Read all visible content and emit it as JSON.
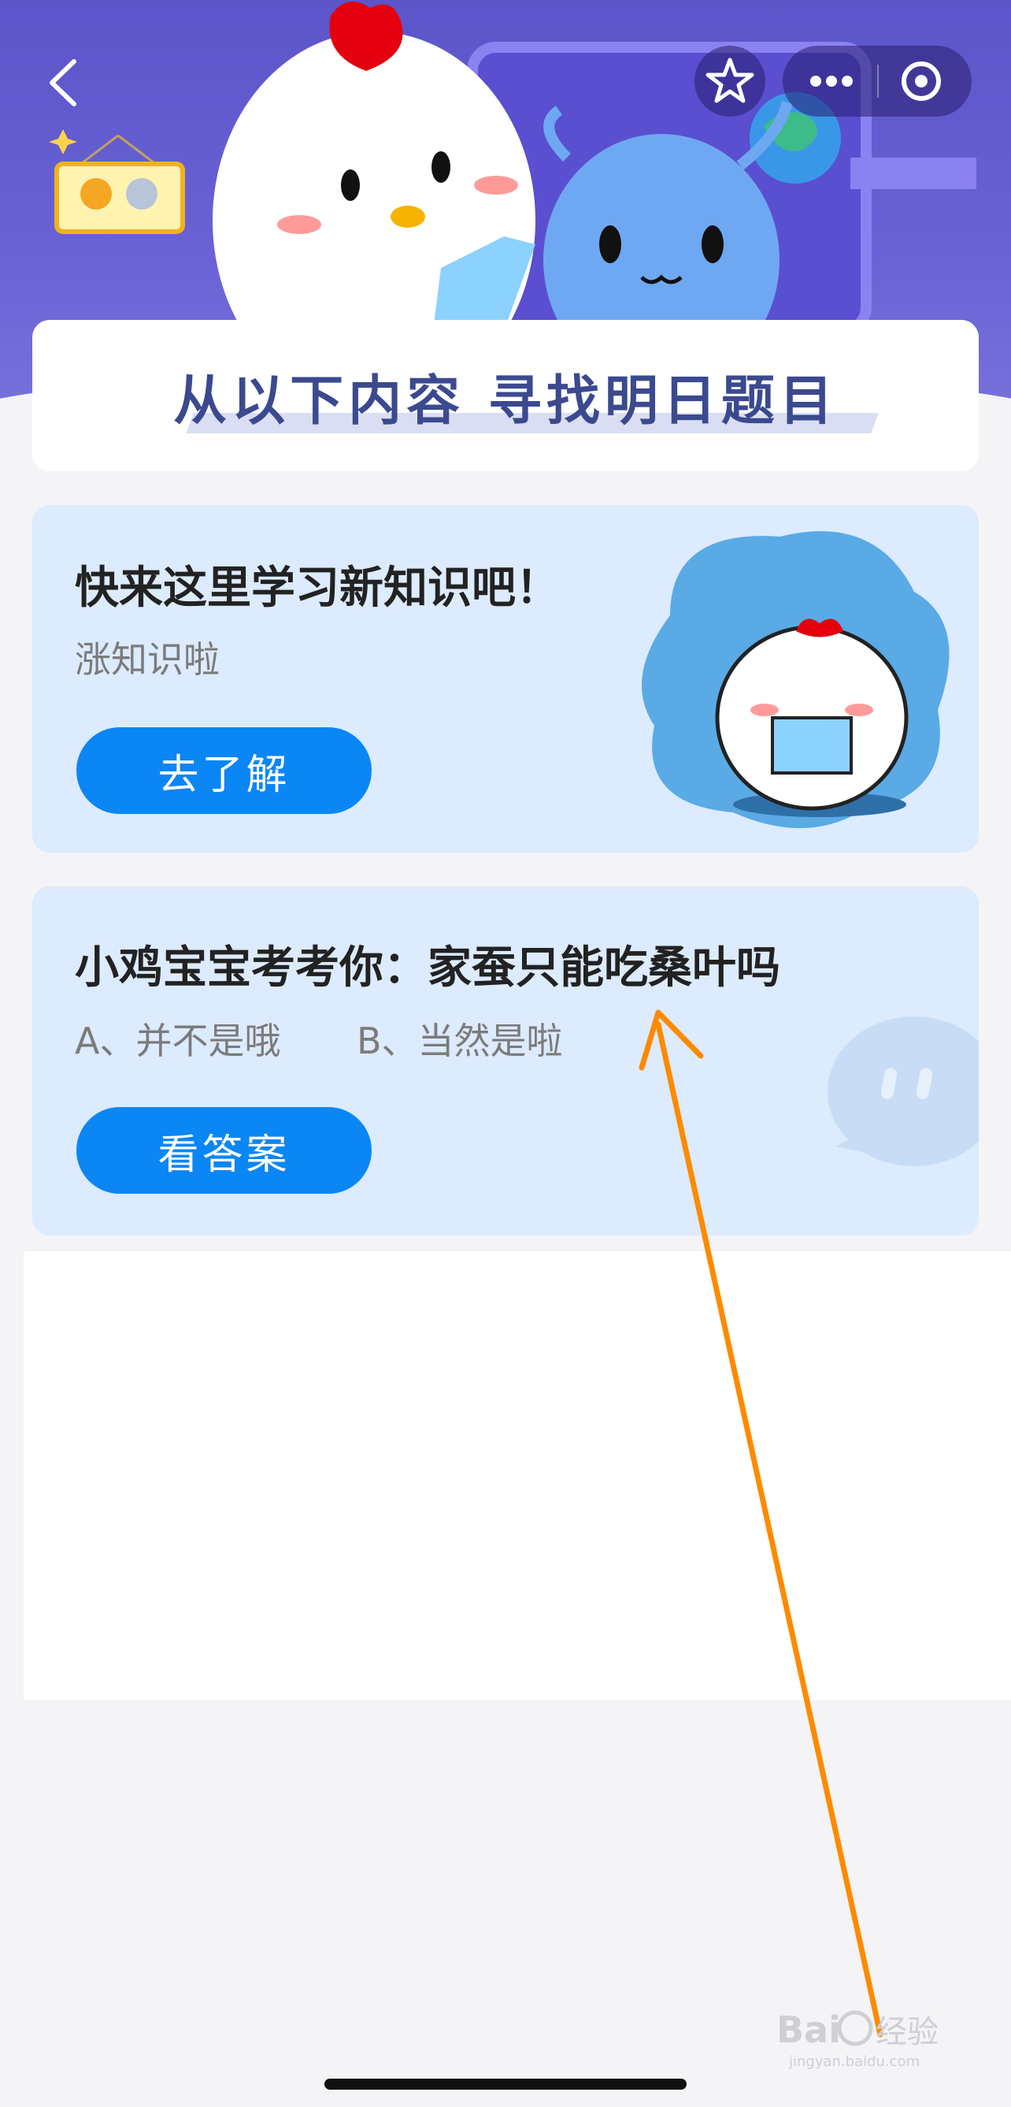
{
  "header": {
    "back_icon": "chevron-left-icon",
    "favorite_icon": "star-icon",
    "more_icon": "more-dots-icon",
    "close_icon": "target-icon",
    "hero_colors": {
      "top": "#5b55c9",
      "bottom": "#7a74dc"
    }
  },
  "banner": {
    "title": "从以下内容  寻找明日题目"
  },
  "card_learn": {
    "title": "快来这里学习新知识吧！",
    "subtitle": "涨知识啦",
    "button_label": "去了解"
  },
  "card_quiz": {
    "title": "小鸡宝宝考考你：家蚕只能吃桑叶吗",
    "option_a": "A、并不是哦",
    "option_b": "B、当然是啦",
    "button_label": "看答案"
  },
  "watermark": {
    "brand": "Bai",
    "brand_cn": "经验",
    "url": "jingyan.baidu.com"
  },
  "colors": {
    "accent": "#0b86f5",
    "card_bg": "#dcebfd",
    "annotation_arrow": "#ff8a00"
  }
}
